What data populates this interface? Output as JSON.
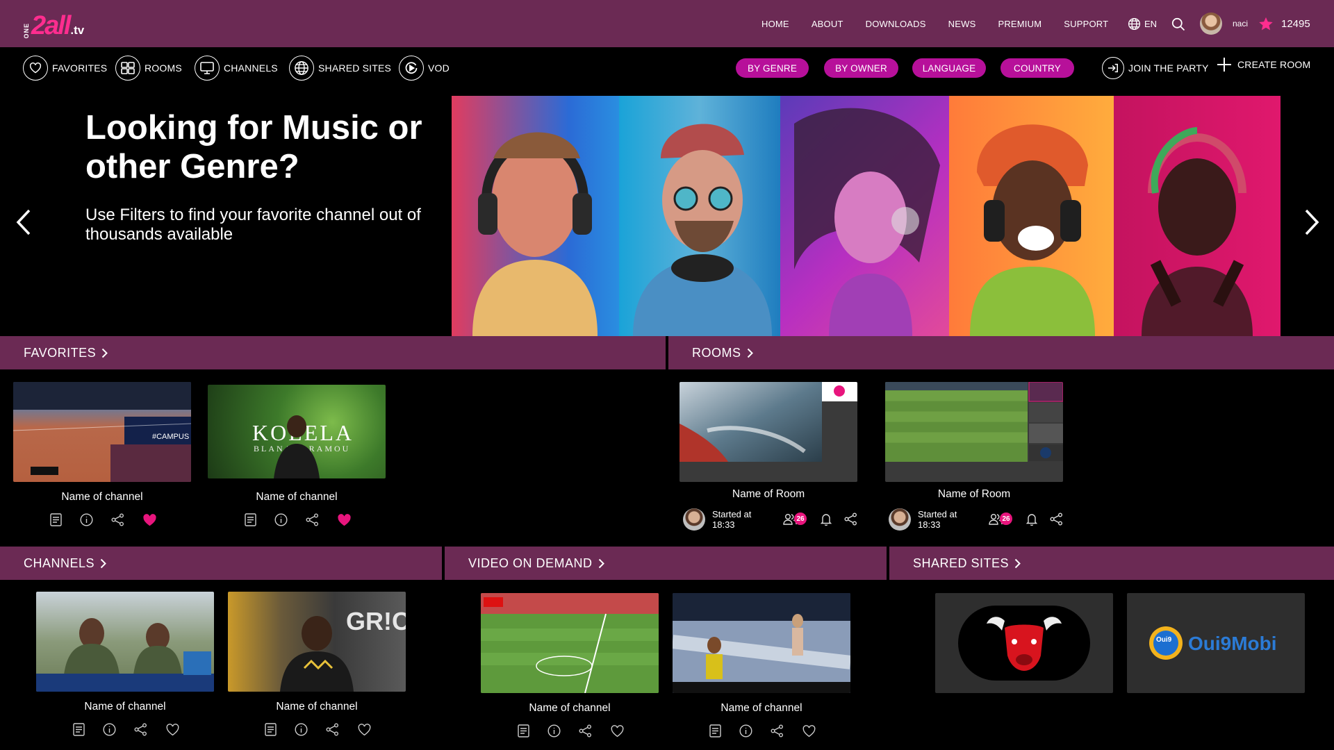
{
  "brand": {
    "one": "ONE",
    "name": "2all",
    "suffix": ".tv",
    "accent": "#ff2d8f",
    "bar_color": "#6b2a54",
    "pill_color": "#b7109a"
  },
  "topnav": [
    "HOME",
    "ABOUT",
    "DOWNLOADS",
    "NEWS",
    "PREMIUM",
    "SUPPORT"
  ],
  "lang": "EN",
  "user": {
    "name": "naci",
    "points": "12495"
  },
  "categories": [
    {
      "label": "FAVORITES",
      "icon": "heart-icon"
    },
    {
      "label": "ROOMS",
      "icon": "rooms-icon"
    },
    {
      "label": "CHANNELS",
      "icon": "tv-icon"
    },
    {
      "label": "SHARED SITES",
      "icon": "globe-icon"
    },
    {
      "label": "VOD",
      "icon": "play-icon"
    }
  ],
  "filters": [
    "BY GENRE",
    "BY OWNER",
    "LANGUAGE",
    "COUNTRY"
  ],
  "actions": {
    "join": "JOIN THE PARTY",
    "create": "CREATE ROOM"
  },
  "hero": {
    "title": "Looking for Music or other Genre?",
    "subtitle": "Use Filters to find your favorite channel out of thousands available"
  },
  "sections": {
    "favorites": "FAVORITES",
    "rooms": "ROOMS",
    "channels": "CHANNELS",
    "vod": "VIDEO ON DEMAND",
    "shared": "SHARED SITES"
  },
  "favorites": [
    {
      "name": "Name of channel",
      "thumb_text": "#CAMPUS",
      "favorited": true
    },
    {
      "name": "Name of channel",
      "thumb_text": "KOLELA",
      "thumb_sub": "BLANA IBRAMOU",
      "favorited": true
    }
  ],
  "rooms": [
    {
      "name": "Name of Room",
      "started_label": "Started at",
      "time": "18:33",
      "members": "26"
    },
    {
      "name": "Name of Room",
      "started_label": "Started at",
      "time": "18:33",
      "members": "26"
    }
  ],
  "channels": [
    {
      "name": "Name of channel",
      "favorited": false
    },
    {
      "name": "Name of channel",
      "thumb_text": "GR!C",
      "favorited": false
    }
  ],
  "vod": [
    {
      "name": "Name of channel",
      "favorited": false
    },
    {
      "name": "Name of channel",
      "favorited": false
    }
  ],
  "shared_sites": [
    {
      "name": "bull-logo"
    },
    {
      "name": "Oui9Mobi",
      "badge": "Oui9"
    }
  ]
}
